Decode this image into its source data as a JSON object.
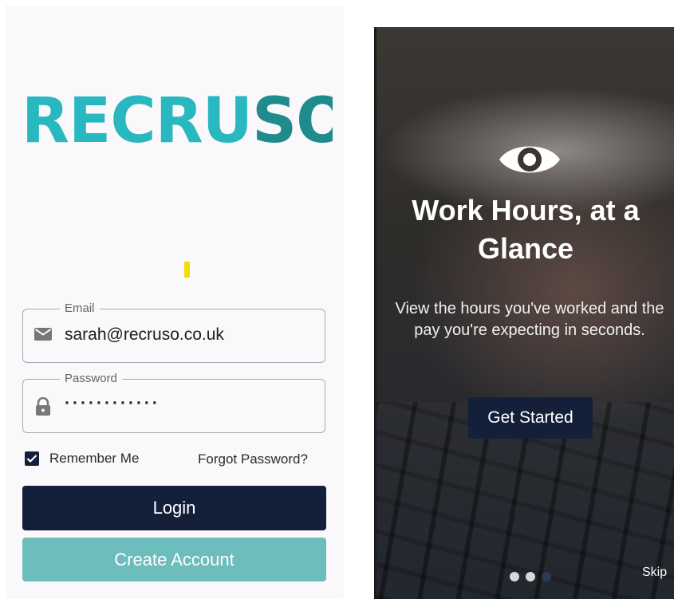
{
  "login_screen": {
    "logo": {
      "part1": "RECRU",
      "part2": "SO"
    },
    "colors": {
      "logo_primary": "#2ab8c0",
      "logo_secondary": "#1f8b8d",
      "navy": "#14203a",
      "teal_button": "#6dbdbd"
    },
    "email": {
      "label": "Email",
      "value": "sarah@recruso.co.uk",
      "icon": "mail-icon"
    },
    "password": {
      "label": "Password",
      "value": "············",
      "icon": "lock-icon"
    },
    "remember": {
      "label": "Remember Me",
      "checked": true
    },
    "forgot_label": "Forgot Password?",
    "login_label": "Login",
    "create_label": "Create Account"
  },
  "onboarding": {
    "icon": "eye-icon",
    "title_line1": "Work Hours, at a",
    "title_line2": "Glance",
    "description": "View the hours you've worked and the pay you're expecting in seconds.",
    "cta_label": "Get Started",
    "page_indicator": {
      "total": 3,
      "active": 3
    },
    "skip_label": "Skip"
  }
}
